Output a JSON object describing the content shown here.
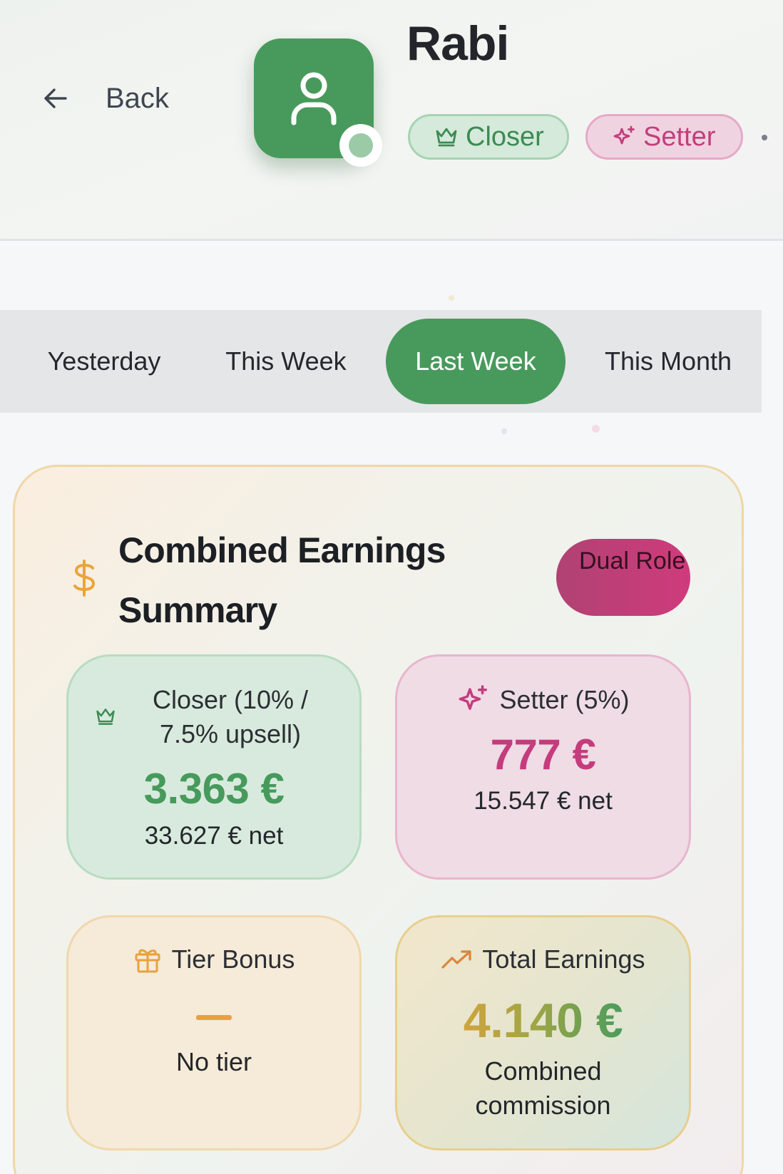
{
  "header": {
    "back_label": "Back",
    "user_name": "Rabi",
    "roles": [
      {
        "label": "Closer",
        "icon": "crown-icon",
        "color": "#3d8a53"
      },
      {
        "label": "Setter",
        "icon": "sparkles-icon",
        "color": "#c23e7c"
      }
    ]
  },
  "period_tabs": {
    "items": [
      "Yesterday",
      "This Week",
      "Last Week",
      "This Month"
    ],
    "active": "Last Week"
  },
  "summary": {
    "title": "Combined Earnings Summary",
    "badge": "Dual Role",
    "closer": {
      "label": "Closer (10% / 7.5% upsell)",
      "amount": "3.363 €",
      "net": "33.627 € net"
    },
    "setter": {
      "label": "Setter (5%)",
      "amount": "777 €",
      "net": "15.547 € net"
    },
    "tier": {
      "label": "Tier Bonus",
      "value": "—",
      "note": "No tier"
    },
    "total": {
      "label": "Total Earnings",
      "amount": "4.140 €",
      "note": "Combined commission"
    }
  },
  "colors": {
    "primary_green": "#489a5c",
    "setter_pink": "#c53c7d",
    "tier_orange": "#e8a23c"
  }
}
